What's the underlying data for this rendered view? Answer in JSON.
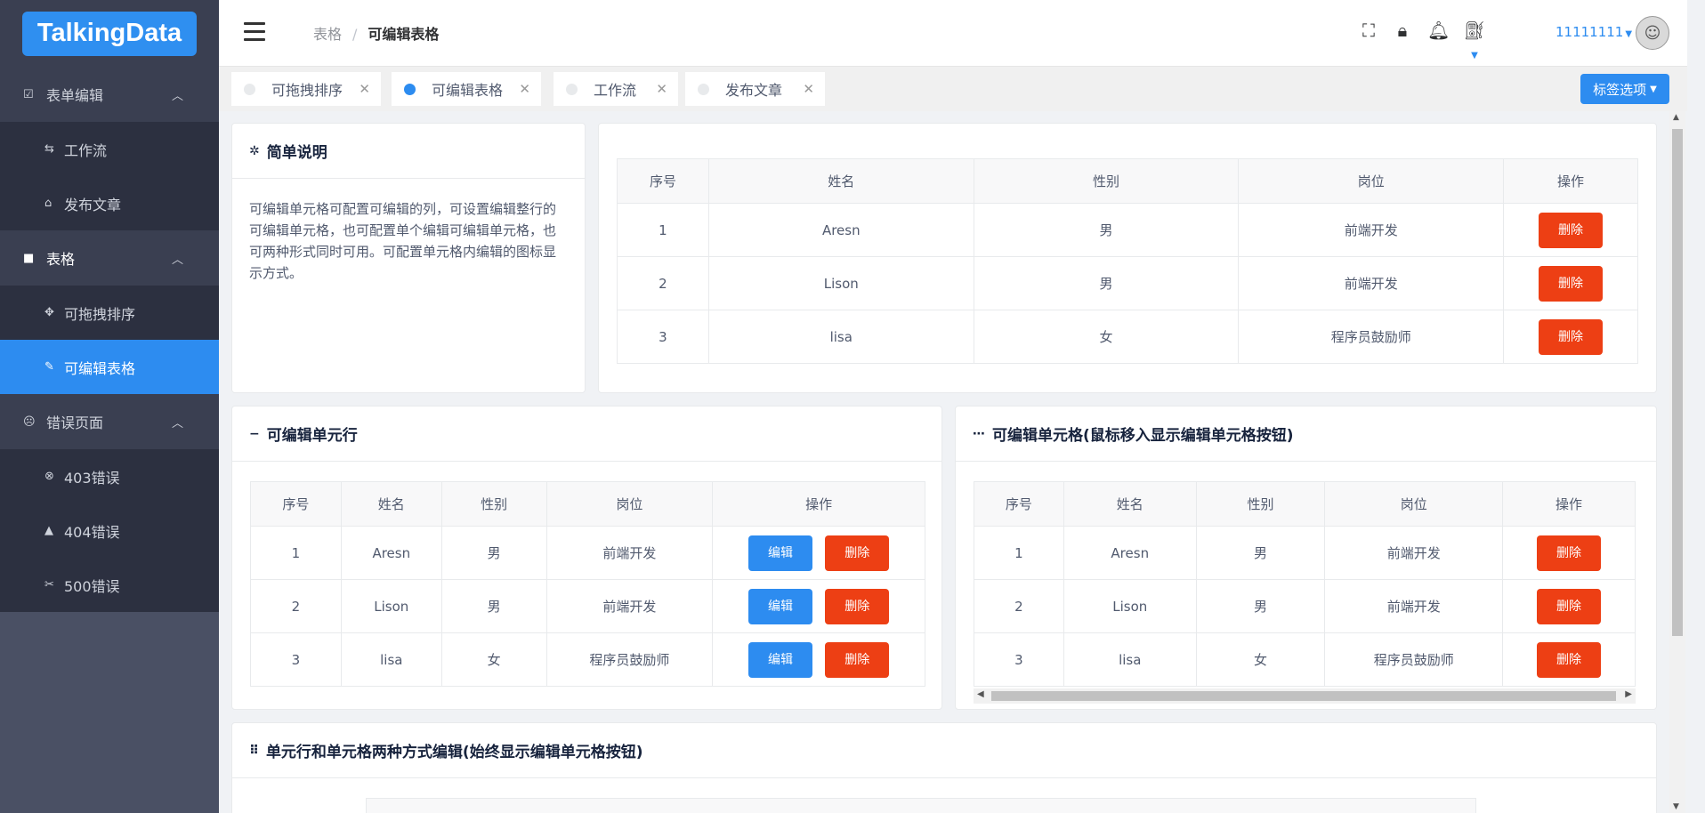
{
  "logo": "TalkingData",
  "sidebar": {
    "groups": [
      {
        "label": "表单编辑",
        "icon": "checkbox-icon",
        "items": [
          {
            "label": "工作流",
            "icon": "swap-icon"
          },
          {
            "label": "发布文章",
            "icon": "home-icon"
          }
        ]
      },
      {
        "label": "表格",
        "icon": "table-icon",
        "items": [
          {
            "label": "可拖拽排序",
            "icon": "move-icon"
          },
          {
            "label": "可编辑表格",
            "icon": "pencil-icon"
          }
        ]
      },
      {
        "label": "错误页面",
        "icon": "sad-face-icon",
        "items": [
          {
            "label": "403错误",
            "icon": "close-circle-icon"
          },
          {
            "label": "404错误",
            "icon": "warning-icon"
          },
          {
            "label": "500错误",
            "icon": "tools-icon"
          }
        ]
      }
    ],
    "active": "可编辑表格"
  },
  "header": {
    "breadcrumb": [
      "表格",
      "可编辑表格"
    ],
    "user": "11111111"
  },
  "tabs": [
    {
      "label": "可拖拽排序",
      "active": false
    },
    {
      "label": "可编辑表格",
      "active": true
    },
    {
      "label": "工作流",
      "active": false
    },
    {
      "label": "发布文章",
      "active": false
    }
  ],
  "tab_options_label": "标签选项",
  "desc_card": {
    "title": "简单说明",
    "text": "可编辑单元格可配置可编辑的列，可设置编辑整行的可编辑单元格，也可配置单个编辑可编辑单元格，也可两种形式同时可用。可配置单元格内编辑的图标显示方式。"
  },
  "table_headers": [
    "序号",
    "姓名",
    "性别",
    "岗位",
    "操作"
  ],
  "rows": [
    {
      "id": "1",
      "name": "Aresn",
      "gender": "男",
      "job": "前端开发"
    },
    {
      "id": "2",
      "name": "Lison",
      "gender": "男",
      "job": "前端开发"
    },
    {
      "id": "3",
      "name": "lisa",
      "gender": "女",
      "job": "程序员鼓励师"
    }
  ],
  "buttons": {
    "delete": "删除",
    "edit": "编辑"
  },
  "card_row": {
    "title": "可编辑单元行"
  },
  "card_cell": {
    "title": "可编辑单元格(鼠标移入显示编辑单元格按钮)"
  },
  "card_both": {
    "title": "单元行和单元格两种方式编辑(始终显示编辑单元格按钮)"
  },
  "colors": {
    "primary": "#2d8cf0",
    "danger": "#ed3f14",
    "sidebar": "#4a5064"
  }
}
